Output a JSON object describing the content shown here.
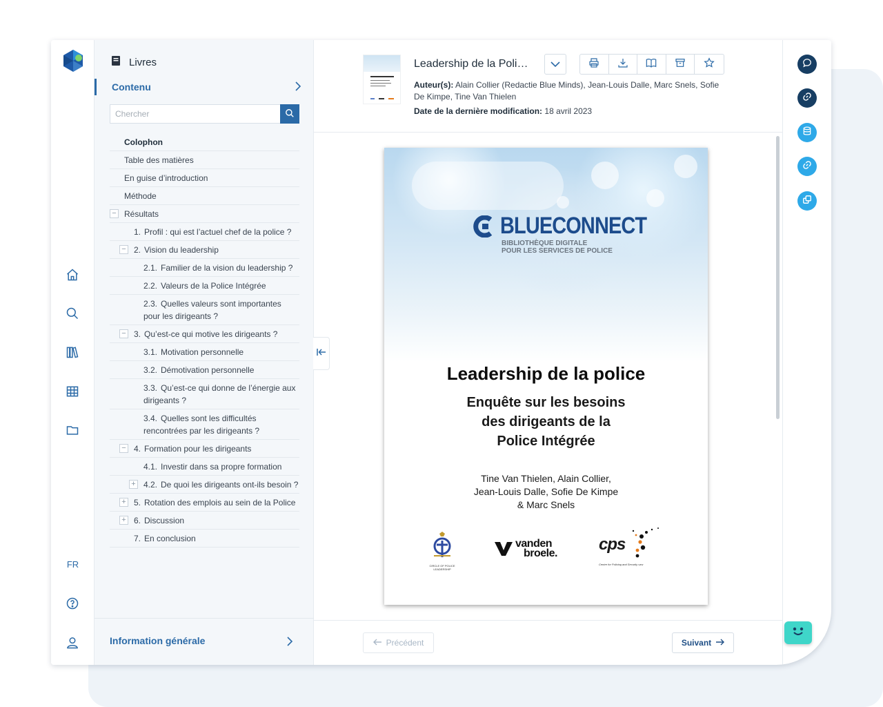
{
  "sidebar": {
    "title": "Livres",
    "tab_label": "Contenu",
    "search_placeholder": "Chercher",
    "toc": [
      {
        "label": "Colophon",
        "num": "",
        "level": 0,
        "toggle": "",
        "active": true
      },
      {
        "label": "Table des matières",
        "num": "",
        "level": 0,
        "toggle": ""
      },
      {
        "label": "En guise d’introduction",
        "num": "",
        "level": 0,
        "toggle": ""
      },
      {
        "label": "Méthode",
        "num": "",
        "level": 0,
        "toggle": ""
      },
      {
        "label": "Résultats",
        "num": "",
        "level": 0,
        "toggle": "−"
      },
      {
        "label": "Profil : qui est l’actuel chef de la police ?",
        "num": "1.",
        "level": 1,
        "toggle": ""
      },
      {
        "label": "Vision du leadership",
        "num": "2.",
        "level": 1,
        "toggle": "−"
      },
      {
        "label": "Familier de la vision du leadership ?",
        "num": "2.1.",
        "level": 2,
        "toggle": ""
      },
      {
        "label": "Valeurs de la Police Intégrée",
        "num": "2.2.",
        "level": 2,
        "toggle": ""
      },
      {
        "label": "Quelles valeurs sont importantes pour les dirigeants ?",
        "num": "2.3.",
        "level": 2,
        "toggle": ""
      },
      {
        "label": "Qu’est-ce qui motive les dirigeants ?",
        "num": "3.",
        "level": 1,
        "toggle": "−"
      },
      {
        "label": "Motivation personnelle",
        "num": "3.1.",
        "level": 2,
        "toggle": ""
      },
      {
        "label": "Démotivation personnelle",
        "num": "3.2.",
        "level": 2,
        "toggle": ""
      },
      {
        "label": "Qu’est-ce qui donne de l’énergie aux dirigeants ?",
        "num": "3.3.",
        "level": 2,
        "toggle": ""
      },
      {
        "label": "Quelles sont les difficultés rencontrées par les dirigeants ?",
        "num": "3.4.",
        "level": 2,
        "toggle": ""
      },
      {
        "label": "Formation pour les dirigeants",
        "num": "4.",
        "level": 1,
        "toggle": "−"
      },
      {
        "label": "Investir dans sa propre formation",
        "num": "4.1.",
        "level": 2,
        "toggle": ""
      },
      {
        "label": "De quoi les dirigeants ont-ils besoin ?",
        "num": "4.2.",
        "level": 2,
        "toggle": "+"
      },
      {
        "label": "Rotation des emplois au sein de la Police",
        "num": "5.",
        "level": 1,
        "toggle": "+"
      },
      {
        "label": "Discussion",
        "num": "6.",
        "level": 1,
        "toggle": "+"
      },
      {
        "label": "En conclusion",
        "num": "7.",
        "level": 1,
        "toggle": ""
      }
    ],
    "footer_label": "Information générale"
  },
  "rail": {
    "items": [
      "home-icon",
      "search-icon",
      "books-icon",
      "grid-icon",
      "folder-icon"
    ],
    "language": "FR",
    "bottom": [
      "help-icon",
      "user-icon"
    ]
  },
  "document": {
    "title": "Leadership de la Poli…",
    "authors_label": "Auteur(s):",
    "authors": "Alain Collier (Redactie Blue Minds), Jean-Louis Dalle, Marc Snels, Sofie De Kimpe, Tine Van Thielen",
    "date_label": "Date de la dernière modification:",
    "date": "18 avril 2023"
  },
  "toolbar": [
    "print-icon",
    "download-icon",
    "book-open-icon",
    "archive-icon",
    "star-icon"
  ],
  "page": {
    "brand_blue": "BLUE",
    "brand_connect": "CONNECT",
    "brand_sub1": "BIBLIOTHÈQUE DIGITALE",
    "brand_sub2": "POUR LES SERVICES DE POLICE",
    "title": "Leadership de la police",
    "subtitle": [
      "Enquête sur les besoins",
      "des dirigeants de la",
      "Police Intégrée"
    ],
    "authors": [
      "Tine Van Thielen, Alain Collier,",
      "Jean-Louis Dalle, Sofie De Kimpe",
      "& Marc Snels"
    ],
    "logo1_text": "CIRCLE OF POLICE LEADERSHIP",
    "logo2_line1": "vanden",
    "logo2_line2": "broele.",
    "logo3_word": "cps",
    "logo3_text": "Centre for Policing and Security vzw"
  },
  "footer": {
    "prev_label": "Précédent",
    "next_label": "Suivant"
  },
  "right_rail": [
    "comment-icon",
    "link-icon",
    "database-icon",
    "link-alt-icon",
    "copy-icon"
  ],
  "colors": {
    "primary": "#2b6aa7",
    "navy": "#173e63",
    "sky": "#2ea9e8",
    "mint": "#3fd6c9"
  }
}
